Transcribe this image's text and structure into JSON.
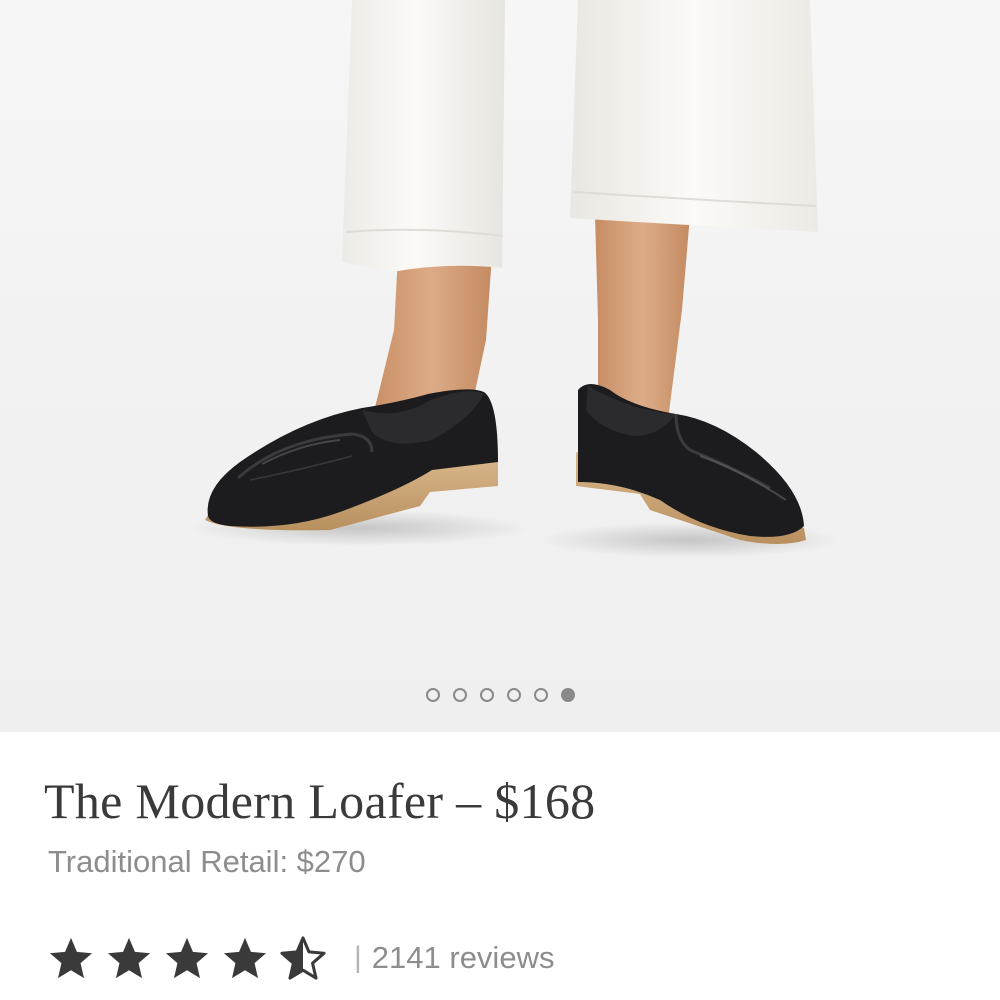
{
  "gallery": {
    "image_subject": "model wearing white cropped trousers and black leather loafers with wooden heels",
    "dot_count": 6,
    "active_index": 5
  },
  "product": {
    "title": "The Modern Loafer – $168",
    "retail": "Traditional Retail: $270",
    "rating": 4.5,
    "rating_max": 5,
    "separator": "|",
    "reviews": "2141 reviews"
  },
  "colors": {
    "title_text": "#3a3a3a",
    "muted_text": "#8d8d8d",
    "star_fill": "#3a3a3a",
    "dot": "#8a8a8a",
    "loafer_leather": "#1c1c1e",
    "loafer_sole": "#c9a577",
    "trousers": "#f8f7f3",
    "skin": "#d7a47e"
  },
  "icons": {
    "star_full": "star-filled-icon",
    "star_half": "star-half-icon"
  }
}
